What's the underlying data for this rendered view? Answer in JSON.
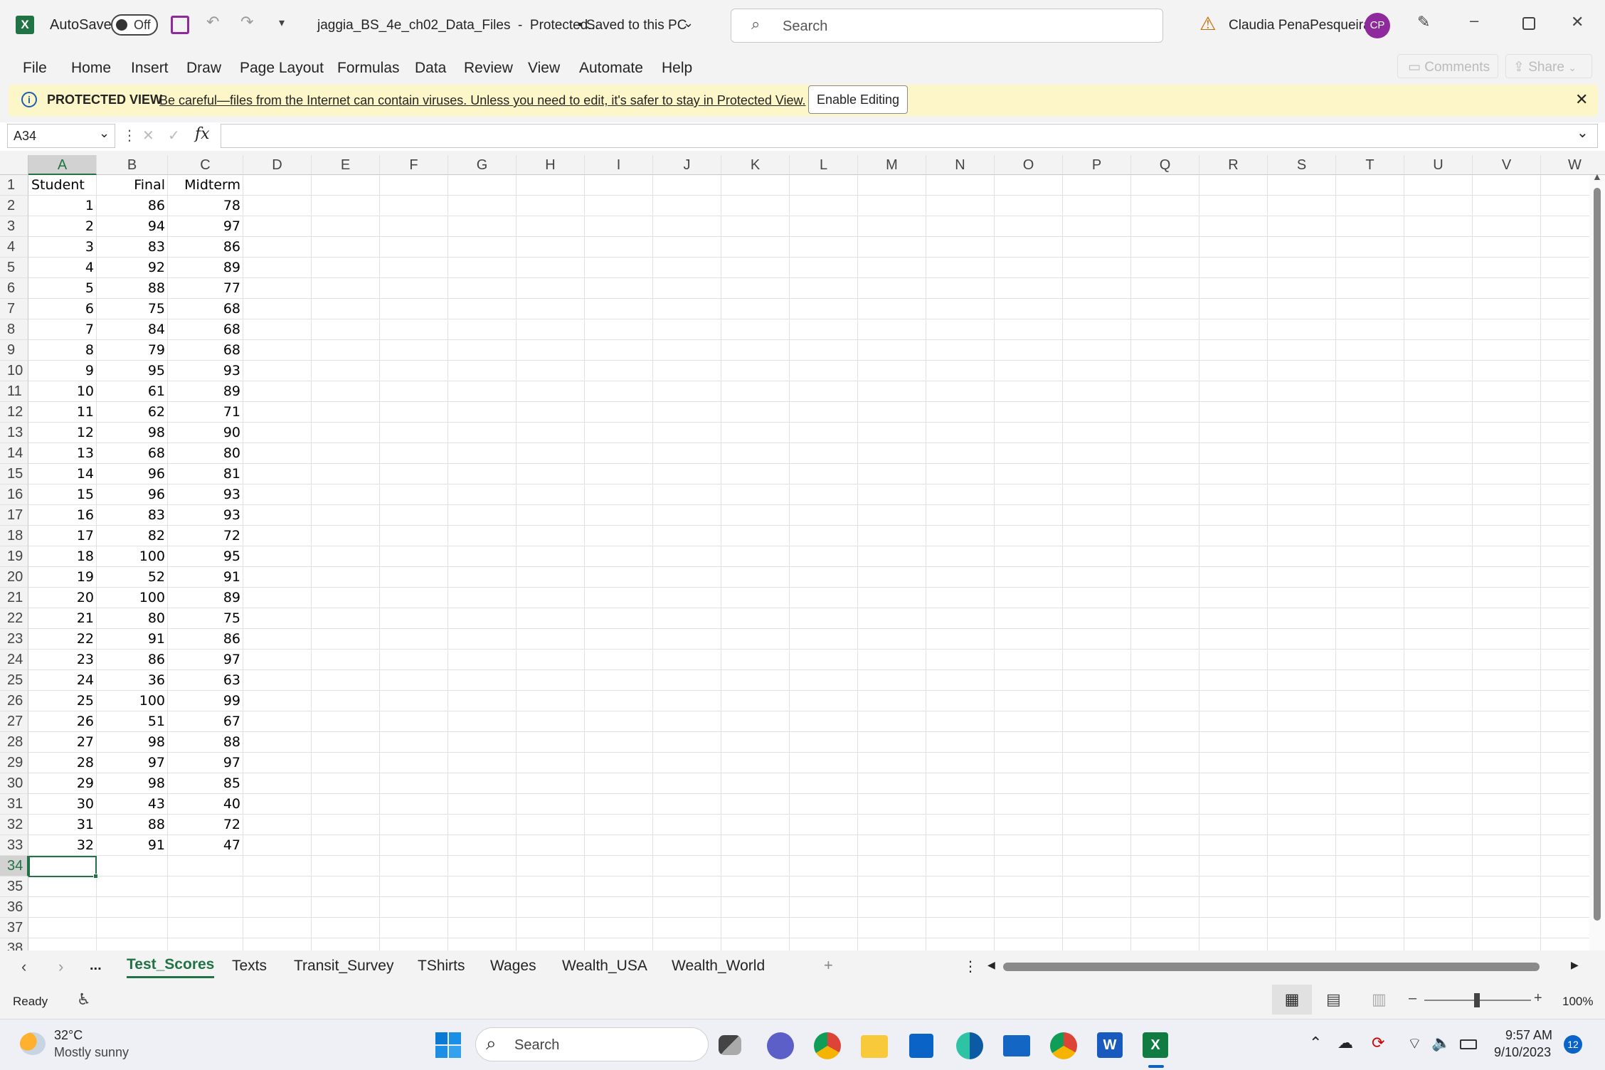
{
  "titlebar": {
    "autosave_label": "AutoSave",
    "autosave_state": "Off",
    "filename": "jaggia_BS_4e_ch02_Data_Files  -  Protected...",
    "save_status": "• Saved to this PC",
    "search_placeholder": "Search",
    "user_name": "Claudia PenaPesqueira",
    "user_initials": "CP"
  },
  "ribbon": {
    "tabs": [
      "File",
      "Home",
      "Insert",
      "Draw",
      "Page Layout",
      "Formulas",
      "Data",
      "Review",
      "View",
      "Automate",
      "Help"
    ],
    "comments_label": "Comments",
    "share_label": "Share"
  },
  "protected_view": {
    "title": "PROTECTED VIEW",
    "message": "Be careful—files from the Internet can contain viruses. Unless you need to edit, it's safer to stay in Protected View.",
    "enable_button": "Enable Editing"
  },
  "formula_bar": {
    "name_box": "A34",
    "fx_label": "fx",
    "formula": ""
  },
  "grid": {
    "columns": [
      "A",
      "B",
      "C",
      "D",
      "E",
      "F",
      "G",
      "H",
      "I",
      "J",
      "K",
      "L",
      "M",
      "N",
      "O",
      "P",
      "Q",
      "R",
      "S",
      "T",
      "U",
      "V",
      "W"
    ],
    "headers": [
      "Student",
      "Final",
      "Midterm"
    ],
    "rows": [
      [
        1,
        86,
        78
      ],
      [
        2,
        94,
        97
      ],
      [
        3,
        83,
        86
      ],
      [
        4,
        92,
        89
      ],
      [
        5,
        88,
        77
      ],
      [
        6,
        75,
        68
      ],
      [
        7,
        84,
        68
      ],
      [
        8,
        79,
        68
      ],
      [
        9,
        95,
        93
      ],
      [
        10,
        61,
        89
      ],
      [
        11,
        62,
        71
      ],
      [
        12,
        98,
        90
      ],
      [
        13,
        68,
        80
      ],
      [
        14,
        96,
        81
      ],
      [
        15,
        96,
        93
      ],
      [
        16,
        83,
        93
      ],
      [
        17,
        82,
        72
      ],
      [
        18,
        100,
        95
      ],
      [
        19,
        52,
        91
      ],
      [
        20,
        100,
        89
      ],
      [
        21,
        80,
        75
      ],
      [
        22,
        91,
        86
      ],
      [
        23,
        86,
        97
      ],
      [
        24,
        36,
        63
      ],
      [
        25,
        100,
        99
      ],
      [
        26,
        51,
        67
      ],
      [
        27,
        98,
        88
      ],
      [
        28,
        97,
        97
      ],
      [
        29,
        98,
        85
      ],
      [
        30,
        43,
        40
      ],
      [
        31,
        88,
        72
      ],
      [
        32,
        91,
        47
      ]
    ],
    "row_numbers": [
      "1",
      "2",
      "3",
      "4",
      "5",
      "6",
      "7",
      "8",
      "9",
      "10",
      "11",
      "12",
      "13",
      "14",
      "15",
      "16",
      "17",
      "18",
      "19",
      "20",
      "21",
      "22",
      "23",
      "24",
      "25",
      "26",
      "27",
      "28",
      "29",
      "30",
      "31",
      "32",
      "33",
      "34",
      "35",
      "36",
      "37",
      "38"
    ],
    "selected_cell": "A34"
  },
  "sheets": {
    "tabs": [
      "Test_Scores",
      "Texts",
      "Transit_Survey",
      "TShirts",
      "Wages",
      "Wealth_USA",
      "Wealth_World"
    ],
    "active": "Test_Scores",
    "more_label": "..."
  },
  "status": {
    "ready": "Ready",
    "zoom": "100%"
  },
  "taskbar": {
    "weather_temp": "32°C",
    "weather_desc": "Mostly sunny",
    "search_placeholder": "Search",
    "time": "9:57 AM",
    "date": "9/10/2023",
    "notification_count": "12"
  },
  "colors": {
    "excel_green": "#217346",
    "pv_bar": "#fdf6c9",
    "avatar": "#8e2a9c"
  }
}
